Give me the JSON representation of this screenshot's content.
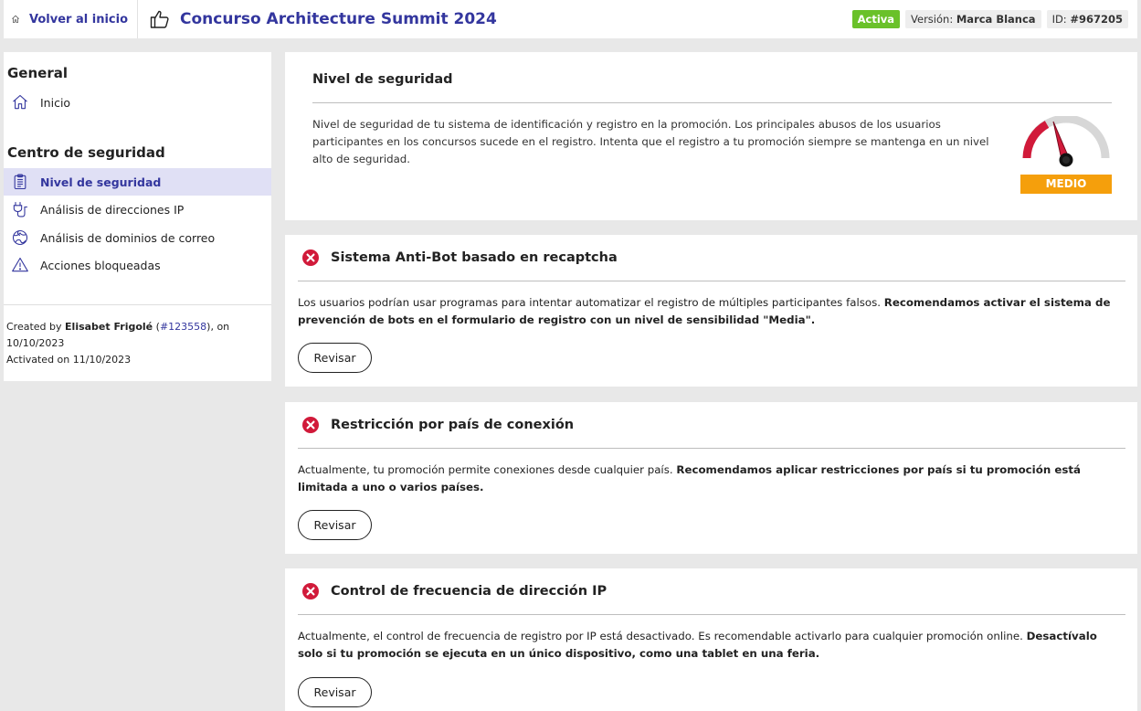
{
  "header": {
    "back_label": "Volver al inicio",
    "title": "Concurso Architecture Summit 2024",
    "status": "Activa",
    "version_prefix": "Versión: ",
    "version_value": "Marca Blanca",
    "id_prefix": "ID: ",
    "id_value": "#967205"
  },
  "sidebar": {
    "general_heading": "General",
    "home_label": "Inicio",
    "security_heading": "Centro de seguridad",
    "items": [
      {
        "label": "Nivel de seguridad",
        "icon": "clipboard-icon",
        "active": true
      },
      {
        "label": "Análisis de direcciones IP",
        "icon": "plug-icon",
        "active": false
      },
      {
        "label": "Análisis de dominios de correo",
        "icon": "globe-icon",
        "active": false
      },
      {
        "label": "Acciones bloqueadas",
        "icon": "warning-icon",
        "active": false
      }
    ],
    "created": {
      "prefix": "Created by ",
      "author": "Elisabet Frigolé",
      "id_open": " (",
      "author_id": "#123558",
      "id_close": "), on",
      "date": "10/10/2023",
      "activated": "Activated on 11/10/2023"
    }
  },
  "security_level": {
    "title": "Nivel de seguridad",
    "description": "Nivel de seguridad de tu sistema de identificación y registro en la promoción. Los principales abusos de los usuarios participantes en los concursos sucede en el registro. Intenta que el registro a tu promoción siempre se mantenga en un nivel alto de seguridad.",
    "gauge_label": "MEDIO",
    "gauge_level": 0.45,
    "colors": {
      "needle": "#d11a3a",
      "gauge_label": "#f59f0c"
    }
  },
  "cards": [
    {
      "title": "Sistema Anti-Bot basado en recaptcha",
      "text": "Los usuarios podrían usar programas para intentar automatizar el registro de múltiples participantes falsos. ",
      "bold": "Recomendamos activar el sistema de prevención de bots en el formulario de registro con un nivel de sensibilidad \"Media\".",
      "button": "Revisar"
    },
    {
      "title": "Restricción por país de conexión",
      "text": "Actualmente, tu promoción permite conexiones desde cualquier país. ",
      "bold": "Recomendamos aplicar restricciones por país si tu promoción está limitada a uno o varios países.",
      "button": "Revisar"
    },
    {
      "title": "Control de frecuencia de dirección IP",
      "text": "Actualmente, el control de frecuencia de registro por IP está desactivado. Es recomendable activarlo para cualquier promoción online. ",
      "bold": "Desactívalo solo si tu promoción se ejecuta en un único dispositivo, como una tablet en una feria.",
      "button": "Revisar"
    }
  ],
  "colors": {
    "brand": "#33369e",
    "active_badge": "#6ac12a",
    "error": "#d11a3a"
  }
}
